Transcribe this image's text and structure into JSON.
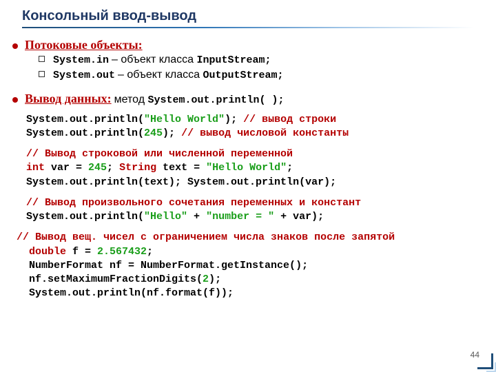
{
  "title": "Консольный ввод-вывод",
  "section1": {
    "heading": "Потоковые объекты:",
    "row1a": "System.in",
    "row1b": "  – объект класса ",
    "row1c": "InputStream;",
    "row2a": "System.out",
    "row2b": " – объект класса ",
    "row2c": "OutputStream;"
  },
  "section2": {
    "heading": "Вывод данных:",
    "tail_plain": "  метод ",
    "tail_mono": "System.out.println( );"
  },
  "code1": {
    "l1a": "System.out.println(",
    "l1b": "\"Hello World\"",
    "l1c": "); ",
    "l1d": "// вывод строки",
    "l2a": "System.out.println(",
    "l2b": "245",
    "l2c": "); ",
    "l2d": "// вывод числовой константы"
  },
  "code2": {
    "c1": "// Вывод строковой или численной переменной",
    "l1a": "int",
    "l1b": " var = ",
    "l1c": "245",
    "l1d": ";      ",
    "l1e": "String",
    "l1f": " text = ",
    "l1g": "\"Hello World\"",
    "l1h": ";",
    "l2": "System.out.println(text); System.out.println(var);"
  },
  "code3": {
    "c1": "// Вывод произвольного сочетания переменных и констант",
    "l1a": "System.out.println(",
    "l1b": "\"Hello\"",
    "l1c": " + ",
    "l1d": "\"number = \"",
    "l1e": " + var);"
  },
  "code4": {
    "c1": "// Вывод вещ. чисел с ограничением числа знаков после запятой",
    "l1a": "double",
    "l1b": " f = ",
    "l1c": "2.567432",
    "l1d": ";",
    "l2": "NumberFormat nf = NumberFormat.getInstance();",
    "l3a": "nf.setMaximumFractionDigits(",
    "l3b": "2",
    "l3c": ");",
    "l4": "System.out.println(nf.format(f));"
  },
  "pagenum": "44"
}
